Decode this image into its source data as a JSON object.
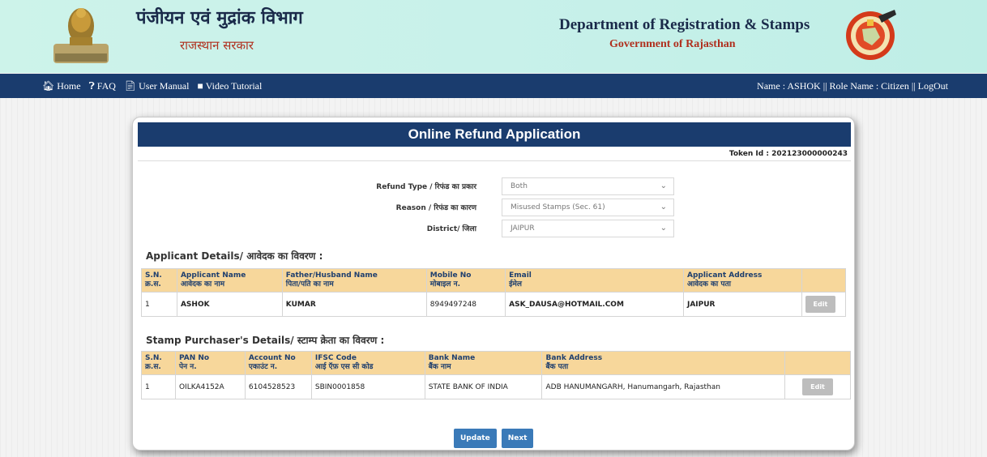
{
  "header": {
    "hindi_title": "पंजीयन एवं मुद्रांक विभाग",
    "hindi_subtitle": "राजस्थान सरकार",
    "english_title": "Department of Registration & Stamps",
    "english_subtitle": "Government of Rajasthan",
    "emblem_icon": "state-emblem-icon",
    "seal_icon": "department-seal-icon"
  },
  "nav": {
    "items": [
      {
        "label": "Home",
        "icon": "home-icon"
      },
      {
        "label": "FAQ",
        "icon": "question-icon"
      },
      {
        "label": "User Manual",
        "icon": "document-icon"
      },
      {
        "label": "Video Tutorial",
        "icon": "video-icon"
      }
    ],
    "user_label": "Name : ASHOK",
    "role_label": "Role Name : Citizen",
    "logout_label": "LogOut"
  },
  "page": {
    "title": "Online Refund Application",
    "token_label": "Token Id : 202123000000243"
  },
  "form": {
    "refund_type_label": "Refund Type / रिफंड का प्रकार",
    "refund_type_value": "Both",
    "reason_label": "Reason / रिफंड का कारण",
    "reason_value": "Misused Stamps (Sec. 61)",
    "district_label": "District/ जिला",
    "district_value": "JAIPUR"
  },
  "applicant": {
    "section_title": "Applicant Details/ आवेदक का विवरण :",
    "headers": [
      [
        "S.N.",
        "क्र.स."
      ],
      [
        "Applicant Name",
        "आवेदक का नाम"
      ],
      [
        "Father/Husband Name",
        "पिता/पति का नाम"
      ],
      [
        "Mobile No",
        "मोबाइल न."
      ],
      [
        "Email",
        "ईमेल"
      ],
      [
        "Applicant Address",
        "आवेदक का पता"
      ]
    ],
    "row": {
      "sn": "1",
      "name": "ASHOK",
      "father": "KUMAR",
      "mobile": "8949497248",
      "email": "ASK_DAUSA@HOTMAIL.COM",
      "address": "JAIPUR"
    },
    "edit_label": "Edit"
  },
  "purchaser": {
    "section_title": "Stamp Purchaser's Details/ स्टाम्प क्रेता का विवरण :",
    "headers": [
      [
        "S.N.",
        "क्र.स."
      ],
      [
        "PAN No",
        "पेन न."
      ],
      [
        "Account No",
        "एकाउंट न."
      ],
      [
        "IFSC Code",
        "आई ऍफ़ एस सी कोड"
      ],
      [
        "Bank Name",
        "बैंक नाम"
      ],
      [
        "Bank Address",
        "बैंक पता"
      ]
    ],
    "row": {
      "sn": "1",
      "pan": "OILKA4152A",
      "account": "6104528523",
      "ifsc": "SBIN0001858",
      "bank": "STATE BANK OF INDIA",
      "bank_address": "ADB HANUMANGARH, Hanumangarh, Rajasthan"
    },
    "edit_label": "Edit"
  },
  "actions": {
    "update_label": "Update",
    "next_label": "Next"
  }
}
